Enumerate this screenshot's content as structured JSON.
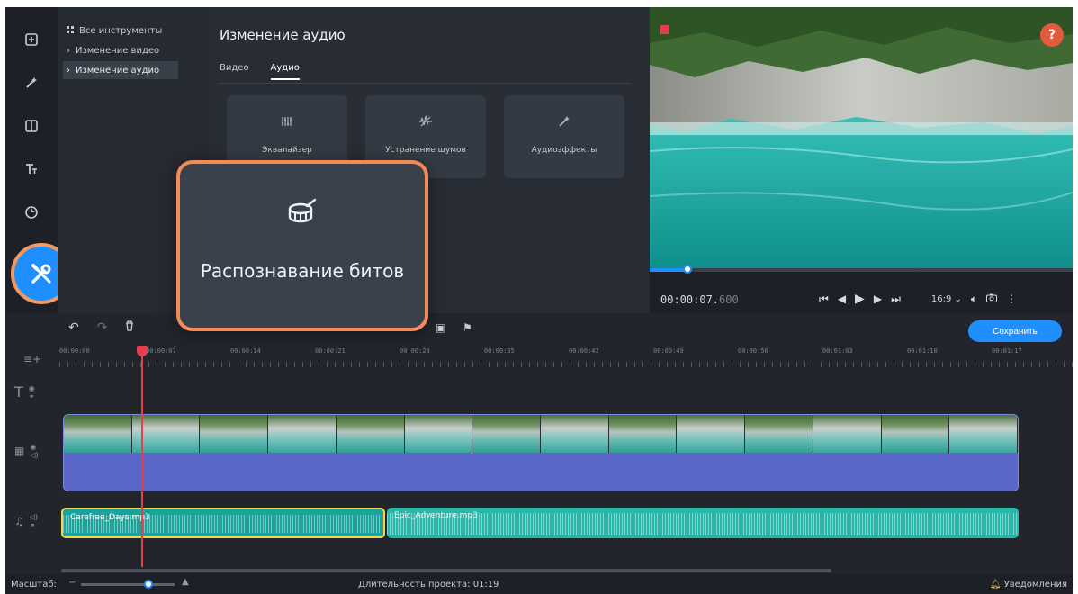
{
  "left_toolbar": {
    "items": [
      "import-icon",
      "magic-wand-icon",
      "transition-icon",
      "text-icon",
      "sticker-icon"
    ],
    "active": "tools-icon"
  },
  "nav": {
    "items": [
      {
        "label": "Все инструменты",
        "icon": "grid-icon",
        "active": false
      },
      {
        "label": "Изменение видео",
        "icon": "chevron-right-icon",
        "active": false
      },
      {
        "label": "Изменение аудио",
        "icon": "chevron-right-icon",
        "active": true
      }
    ]
  },
  "panel": {
    "title": "Изменение аудио",
    "tabs": [
      "Видео",
      "Аудио"
    ],
    "active_tab": "Аудио",
    "cards": [
      {
        "label": "Эквалайзер",
        "icon": "equalizer-icon"
      },
      {
        "label": "Устранение шумов",
        "icon": "noise-removal-icon"
      },
      {
        "label": "Аудиоэффекты",
        "icon": "audio-effects-icon"
      }
    ]
  },
  "popup": {
    "label": "Распознавание битов",
    "icon": "drum-icon"
  },
  "player": {
    "timecode_main": "00:00:07.",
    "timecode_ms": "600",
    "aspect": "16:9",
    "progress_fraction": 0.09
  },
  "help_label": "?",
  "timeline": {
    "save_label": "Сохранить",
    "ruler": [
      "00:00:00",
      "00:00:07",
      "00:00:14",
      "00:00:21",
      "00:00:28",
      "00:00:35",
      "00:00:42",
      "00:00:49",
      "00:00:56",
      "00:01:03",
      "00:01:10",
      "00:01:17"
    ],
    "audio_clips": [
      "Carefree_Days.mp3",
      "Epic_Adventure.mp3"
    ]
  },
  "status": {
    "zoom_label": "Масштаб:",
    "duration": "Длительность проекта: 01:19",
    "notifications": "Уведомления"
  },
  "colors": {
    "accent": "#1f8fff",
    "highlight": "#f28b56",
    "video_track": "#5a67c8",
    "audio_track": "#28b7a8"
  }
}
